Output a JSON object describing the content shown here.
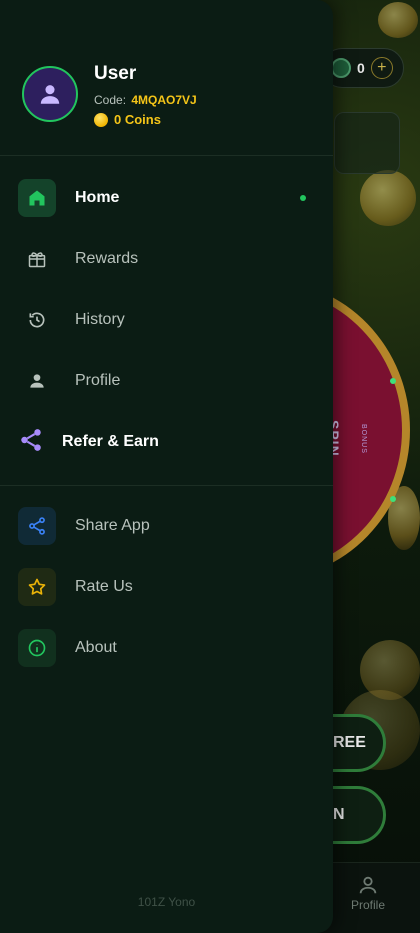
{
  "background_app": {
    "coin_balance": "0",
    "plus_label": "+",
    "spin_label": "SPIN",
    "bonus_label": "BONUS",
    "button_1_partial": "REE",
    "button_2_partial": "N",
    "bottom_nav_profile_label": "Profile"
  },
  "drawer": {
    "user": {
      "name": "User",
      "code_label": "Code:",
      "code_value": "4MQAO7VJ",
      "coins": "0 Coins"
    },
    "menu": [
      {
        "label": "Home",
        "icon": "home-icon",
        "active": true
      },
      {
        "label": "Rewards",
        "icon": "gift-icon",
        "active": false
      },
      {
        "label": "History",
        "icon": "history-icon",
        "active": false
      },
      {
        "label": "Profile",
        "icon": "person-icon",
        "active": false
      },
      {
        "label": "Refer & Earn",
        "icon": "share-icon",
        "active": false
      }
    ],
    "secondary_menu": [
      {
        "label": "Share App",
        "icon": "share-icon",
        "color": "#3b82f6"
      },
      {
        "label": "Rate Us",
        "icon": "star-icon",
        "color": "#eab308"
      },
      {
        "label": "About",
        "icon": "info-icon",
        "color": "#22c55e"
      }
    ],
    "footer": "101Z Yono"
  },
  "colors": {
    "accent": "#22c55e",
    "gold": "#f5c518",
    "drawer_bg": "#0b1c14"
  }
}
